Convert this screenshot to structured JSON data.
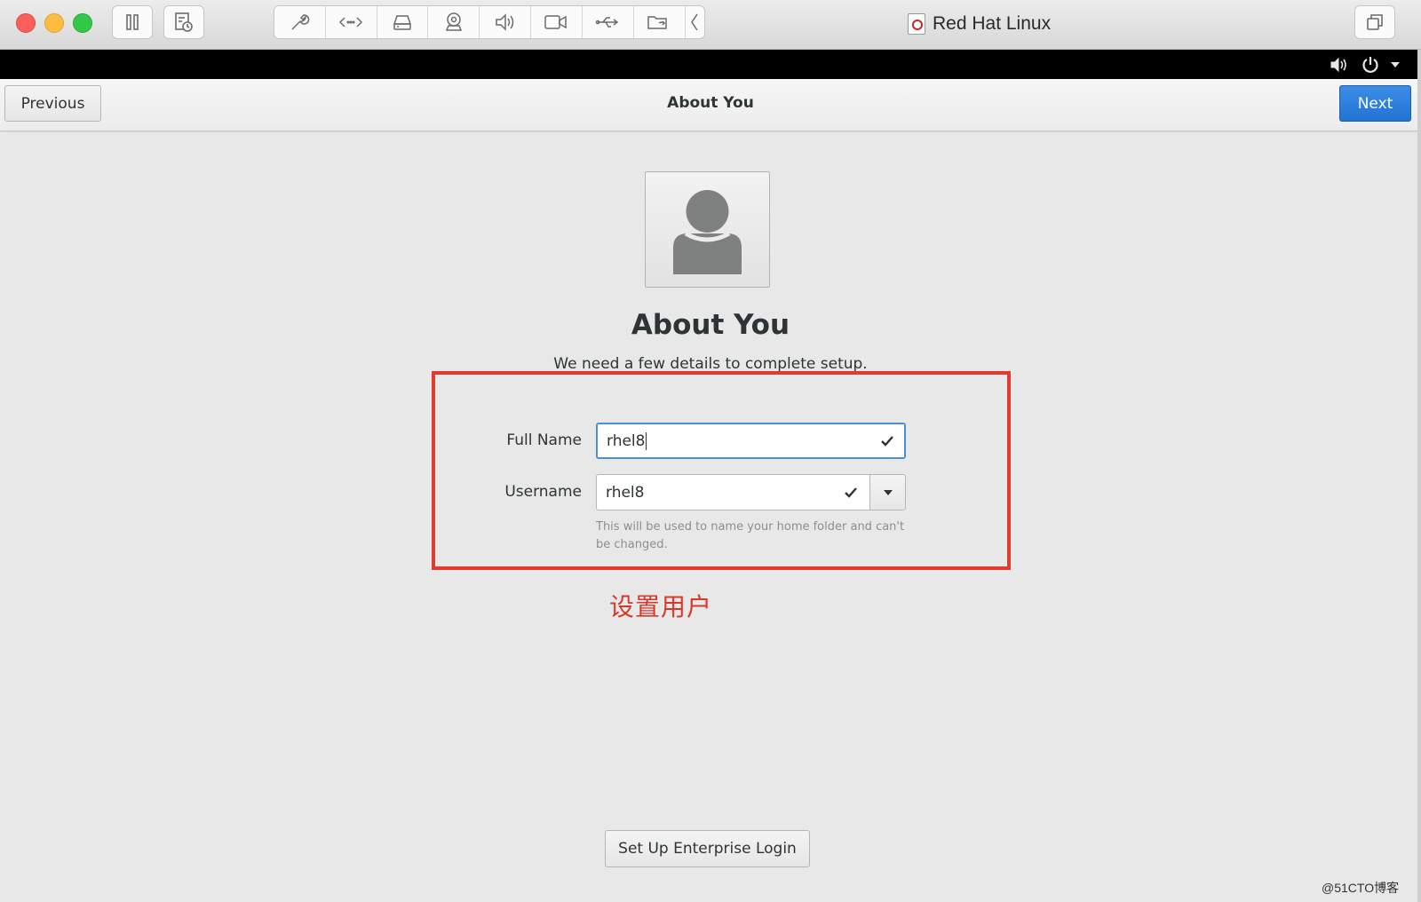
{
  "window": {
    "title": "Red Hat Linux",
    "toolbar_icons": [
      "pause-icon",
      "snapshot-icon",
      "settings-wrench-icon",
      "network-icon",
      "hard-disk-icon",
      "camera-icon",
      "sound-icon",
      "video-icon",
      "usb-icon",
      "shared-folder-icon",
      "collapse-chevron-icon",
      "fullscreen-icon"
    ]
  },
  "system_bar": {
    "icons": [
      "volume-icon",
      "power-icon",
      "dropdown-arrow-icon"
    ]
  },
  "header": {
    "previous_label": "Previous",
    "title": "About You",
    "next_label": "Next",
    "accent_color": "#2a77d6"
  },
  "main": {
    "avatar_icon": "user-avatar-icon",
    "title": "About You",
    "subtitle": "We need a few details to complete setup.",
    "full_name_label": "Full Name",
    "full_name_value": "rhel8",
    "username_label": "Username",
    "username_value": "rhel8",
    "username_hint": "This will be used to name your home folder and can't be changed.",
    "enterprise_login_label": "Set Up Enterprise Login"
  },
  "annotation": {
    "text": "设置用户",
    "color": "#e23b2e"
  },
  "watermark": "@51CTO博客"
}
